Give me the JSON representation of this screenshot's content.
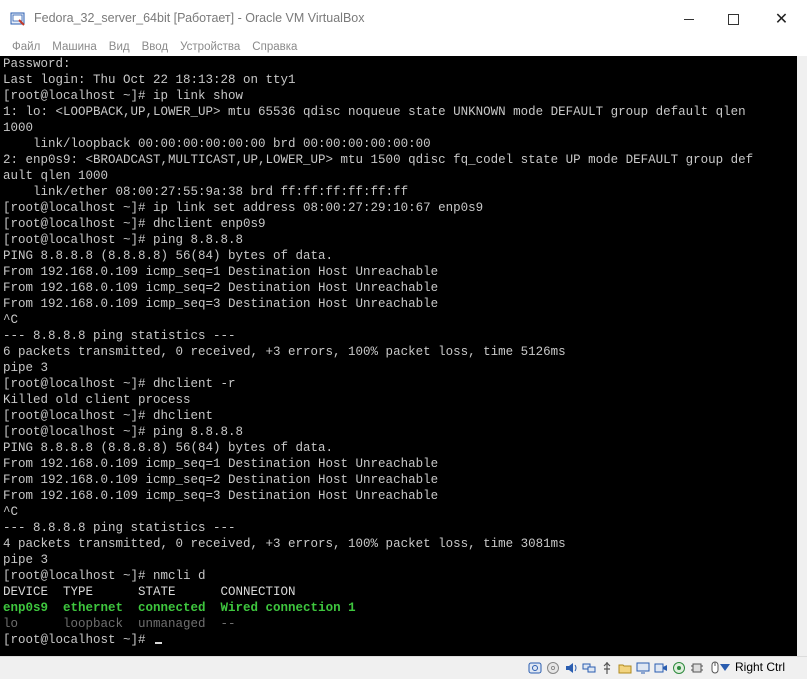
{
  "window": {
    "title": "Fedora_32_server_64bit [Работает] - Oracle VM VirtualBox",
    "minimize_glyph": "",
    "maximize_glyph": "",
    "close_glyph": "✕"
  },
  "menu": {
    "items": [
      "Файл",
      "Машина",
      "Вид",
      "Ввод",
      "Устройства",
      "Справка"
    ]
  },
  "terminal": {
    "lines": [
      "Password:",
      "Last login: Thu Oct 22 18:13:28 on tty1",
      "[root@localhost ~]# ip link show",
      "1: lo: <LOOPBACK,UP,LOWER_UP> mtu 65536 qdisc noqueue state UNKNOWN mode DEFAULT group default qlen",
      "1000",
      "    link/loopback 00:00:00:00:00:00 brd 00:00:00:00:00:00",
      "2: enp0s9: <BROADCAST,MULTICAST,UP,LOWER_UP> mtu 1500 qdisc fq_codel state UP mode DEFAULT group def",
      "ault qlen 1000",
      "    link/ether 08:00:27:55:9a:38 brd ff:ff:ff:ff:ff:ff",
      "[root@localhost ~]# ip link set address 08:00:27:29:10:67 enp0s9",
      "[root@localhost ~]# dhclient enp0s9",
      "[root@localhost ~]# ping 8.8.8.8",
      "PING 8.8.8.8 (8.8.8.8) 56(84) bytes of data.",
      "From 192.168.0.109 icmp_seq=1 Destination Host Unreachable",
      "From 192.168.0.109 icmp_seq=2 Destination Host Unreachable",
      "From 192.168.0.109 icmp_seq=3 Destination Host Unreachable",
      "^C",
      "--- 8.8.8.8 ping statistics ---",
      "6 packets transmitted, 0 received, +3 errors, 100% packet loss, time 5126ms",
      "pipe 3",
      "[root@localhost ~]# dhclient -r",
      "Killed old client process",
      "[root@localhost ~]# dhclient",
      "[root@localhost ~]# ping 8.8.8.8",
      "PING 8.8.8.8 (8.8.8.8) 56(84) bytes of data.",
      "From 192.168.0.109 icmp_seq=1 Destination Host Unreachable",
      "From 192.168.0.109 icmp_seq=2 Destination Host Unreachable",
      "From 192.168.0.109 icmp_seq=3 Destination Host Unreachable",
      "^C",
      "--- 8.8.8.8 ping statistics ---",
      "4 packets transmitted, 0 received, +3 errors, 100% packet loss, time 3081ms",
      "pipe 3",
      "[root@localhost ~]# nmcli d"
    ],
    "nmcli_header": "DEVICE  TYPE      STATE      CONNECTION",
    "nmcli_rows": [
      {
        "device": "enp0s9",
        "type": "ethernet",
        "state": "connected",
        "connection": "Wired connection 1",
        "color": "#3ec63e"
      },
      {
        "device": "lo",
        "type": "loopback",
        "state": "unmanaged",
        "connection": "--",
        "color": "#6f6f6f"
      }
    ],
    "prompt": "[root@localhost ~]# "
  },
  "statusbar": {
    "host_key": "Right Ctrl",
    "icons": [
      "harddisk-icon",
      "optical-drive-icon",
      "audio-icon",
      "network-icon",
      "usb-icon",
      "shared-folder-icon",
      "display-icon",
      "video-capture-icon",
      "recording-icon",
      "cpu-icon",
      "mouse-integration-icon"
    ]
  },
  "colors": {
    "terminal_bg": "#000000",
    "terminal_fg": "#c8c8c8",
    "connected_green": "#3ec63e",
    "unmanaged_gray": "#6f6f6f"
  }
}
